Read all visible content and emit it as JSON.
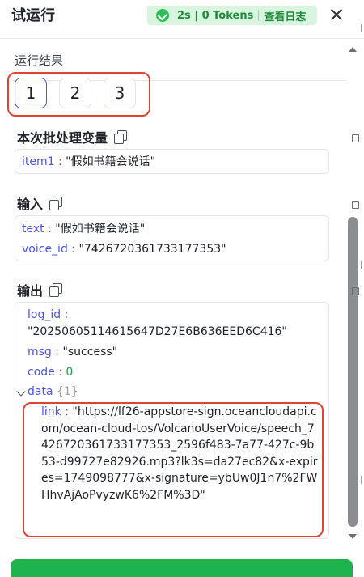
{
  "header": {
    "title": "试运行",
    "status": "2s | 0 Tokens",
    "view_log": "查看日志"
  },
  "results": {
    "label": "运行结果",
    "tabs": [
      "1",
      "2",
      "3"
    ]
  },
  "batch_vars": {
    "title": "本次批处理变量",
    "key": "item1",
    "value": "\"假如书籍会说话\""
  },
  "input": {
    "title": "输入",
    "rows": [
      {
        "key": "text",
        "value": "\"假如书籍会说话\""
      },
      {
        "key": "voice_id",
        "value": "\"7426720361733177353\""
      }
    ]
  },
  "output": {
    "title": "输出",
    "log_id_key": "log_id",
    "log_id_value": "\"20250605114615647D27E6B636EED6C416\"",
    "msg_key": "msg",
    "msg_value": "\"success\"",
    "code_key": "code",
    "code_value": "0",
    "data_key": "data",
    "data_count": "{1}",
    "link_key": "link",
    "link_value": "\"https://lf26-appstore-sign.oceancloudapi.com/ocean-cloud-tos/VolcanoUserVoice/speech_7426720361733177353_2596f483-7a77-427c-9b53-d99727e82926.mp3?lk3s=da27ec82&x-expires=1749098777&x-signature=ybUw0J1n7%2FWHhvAjAoPvyzwK6%2FM%3D\""
  },
  "colors": {
    "accent": "#4d53e8",
    "success": "#1fb34f",
    "highlight": "#e0432f"
  }
}
